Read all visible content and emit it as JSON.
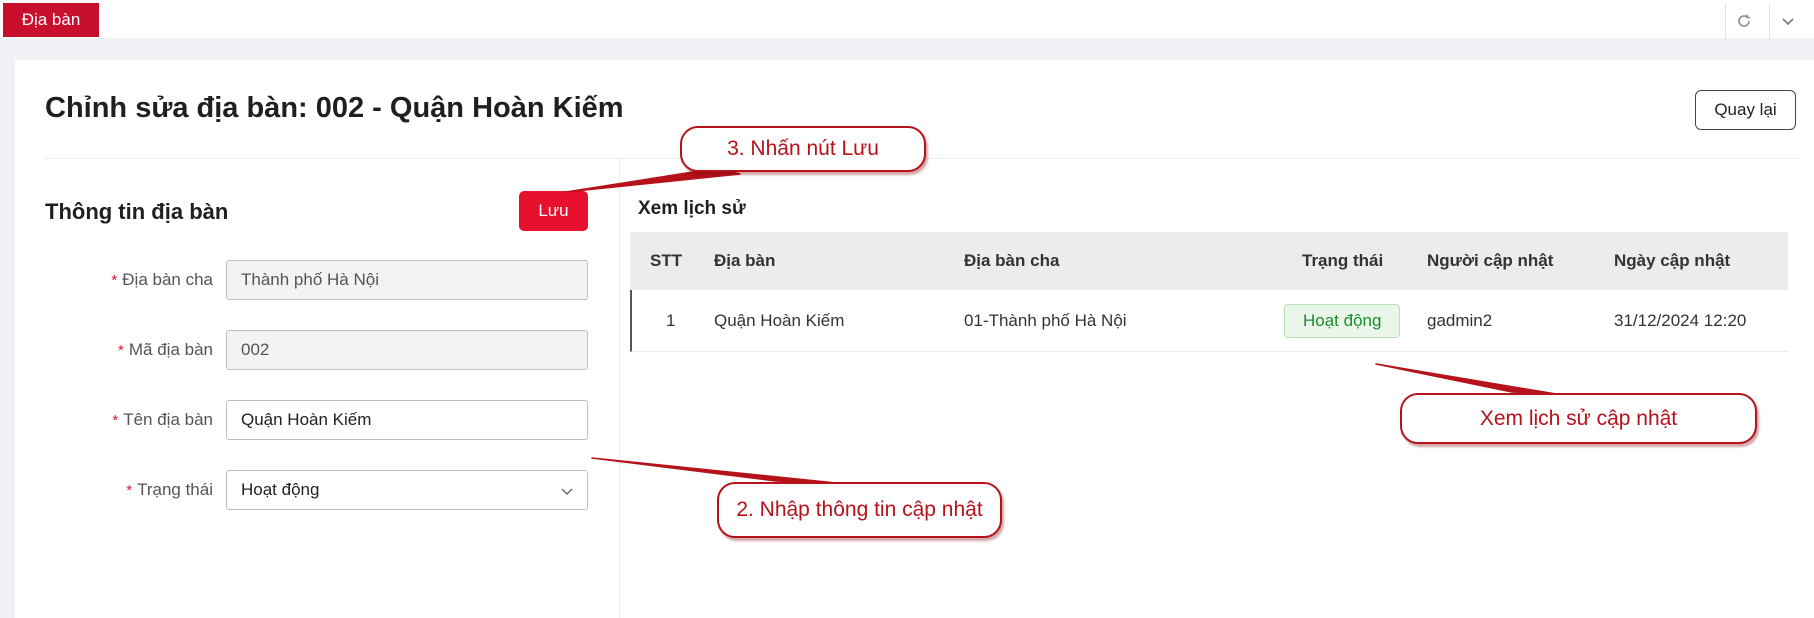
{
  "tabbar": {
    "active_tab": "Địa bàn",
    "refresh_icon": "refresh-icon",
    "dropdown_icon": "chevron-down-icon"
  },
  "page": {
    "title": "Chỉnh sửa địa bàn: 002 - Quận Hoàn Kiếm",
    "back_label": "Quay lại"
  },
  "form": {
    "section_title": "Thông tin địa bàn",
    "save_label": "Lưu",
    "required_mark": "*",
    "fields": [
      {
        "label": "Địa bàn cha",
        "value": "Thành phố Hà Nội",
        "disabled": true
      },
      {
        "label": "Mã địa bàn",
        "value": "002",
        "disabled": true
      },
      {
        "label": "Tên địa bàn",
        "value": "Quận Hoàn Kiếm",
        "disabled": false
      },
      {
        "label": "Trạng thái",
        "value": "Hoạt động",
        "type": "select"
      }
    ]
  },
  "history": {
    "title": "Xem lịch sử",
    "columns": [
      "STT",
      "Địa bàn",
      "Địa bàn cha",
      "Trạng thái",
      "Người cập nhật",
      "Ngày cập nhật"
    ],
    "rows": [
      {
        "stt": "1",
        "dia_ban": "Quận Hoàn Kiếm",
        "dia_ban_cha": "01-Thành phố Hà Nội",
        "trang_thai": "Hoạt động",
        "nguoi_cap_nhat": "gadmin2",
        "ngay_cap_nhat": "31/12/2024 12:20"
      }
    ]
  },
  "annotations": {
    "step3": "3. Nhấn nút Lưu",
    "step2": "2. Nhập thông tin cập nhật",
    "history_note": "Xem lịch sử cập nhật"
  },
  "colors": {
    "brand_red": "#c8102e",
    "save_red": "#e8112d",
    "annotation_red": "#b5121b",
    "status_green": "#1e8a2e"
  }
}
